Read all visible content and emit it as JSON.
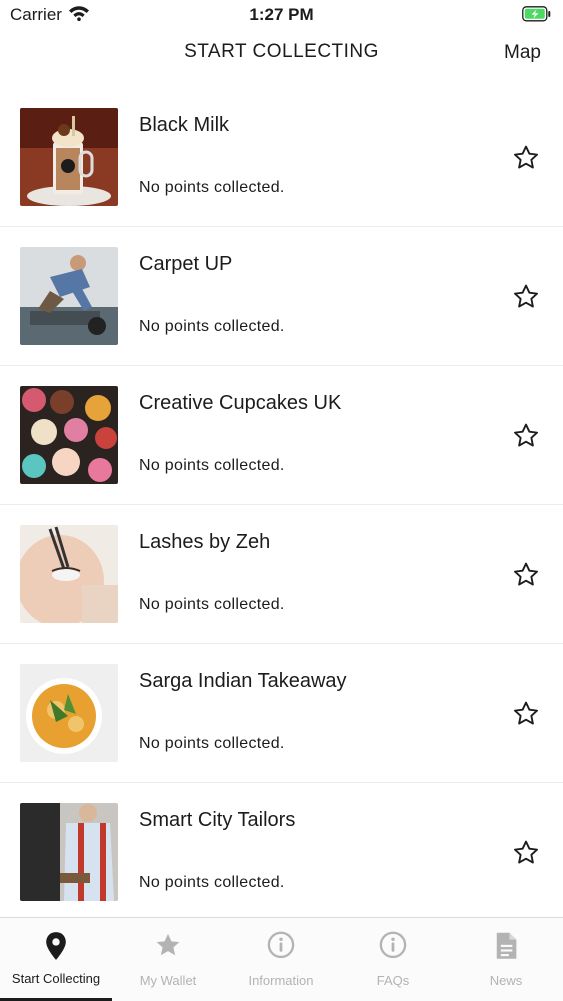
{
  "status_bar": {
    "carrier": "Carrier",
    "time": "1:27 PM"
  },
  "header": {
    "title": "START COLLECTING",
    "map_label": "Map"
  },
  "places": [
    {
      "name": "Black Milk",
      "points": "No points collected."
    },
    {
      "name": "Carpet UP",
      "points": "No points collected."
    },
    {
      "name": "Creative Cupcakes UK",
      "points": "No points collected."
    },
    {
      "name": "Lashes by Zeh",
      "points": "No points collected."
    },
    {
      "name": "Sarga Indian Takeaway",
      "points": "No points collected."
    },
    {
      "name": "Smart City Tailors",
      "points": "No points collected."
    }
  ],
  "tabs": [
    {
      "label": "Start Collecting",
      "icon": "map-pin-icon",
      "active": true
    },
    {
      "label": "My Wallet",
      "icon": "star-icon",
      "active": false
    },
    {
      "label": "Information",
      "icon": "info-icon",
      "active": false
    },
    {
      "label": "FAQs",
      "icon": "info-icon",
      "active": false
    },
    {
      "label": "News",
      "icon": "document-icon",
      "active": false
    }
  ],
  "colors": {
    "active": "#1c1c1c",
    "inactive": "#b3b3b3",
    "battery": "#4cd964"
  }
}
